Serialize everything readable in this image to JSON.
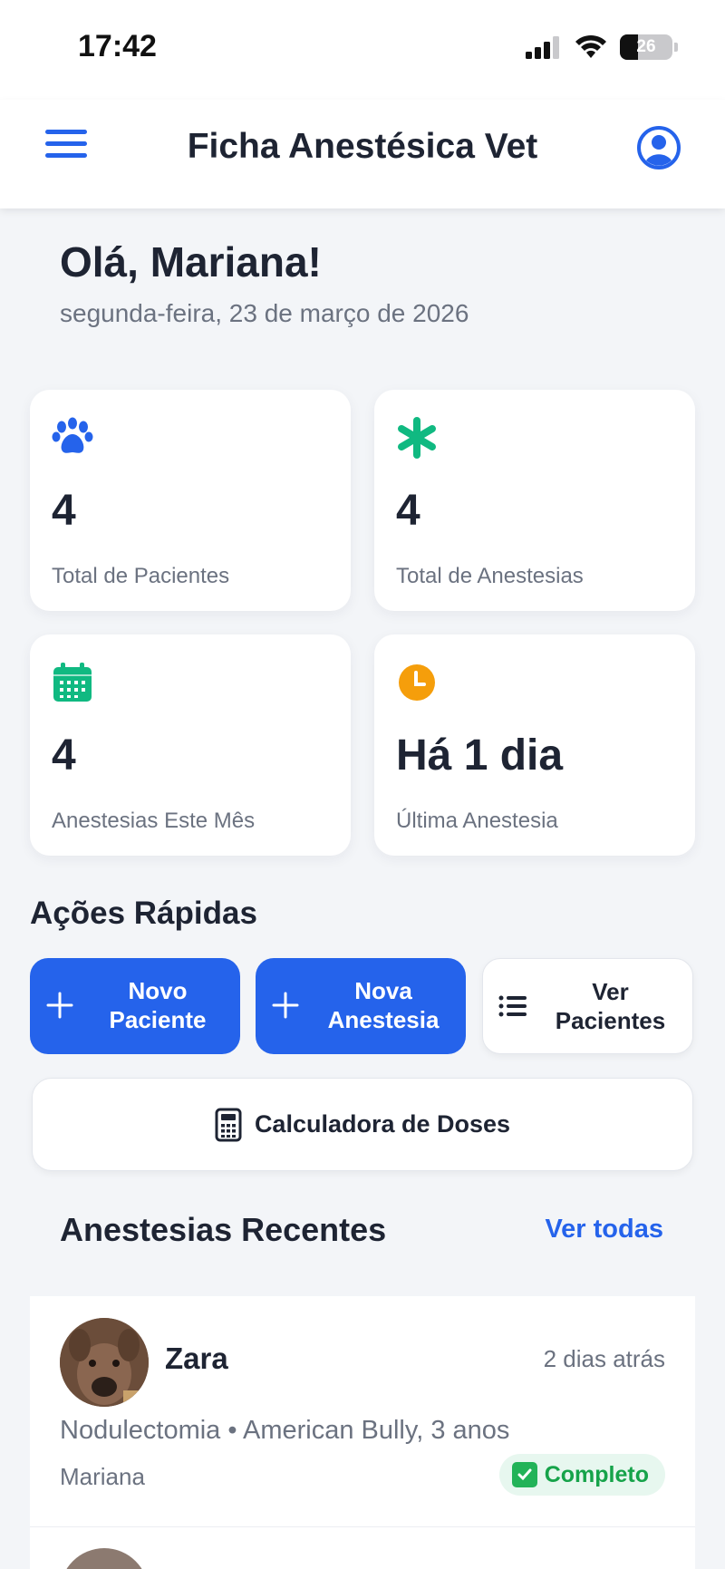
{
  "status_bar": {
    "time": "17:42",
    "battery": "26"
  },
  "header": {
    "title": "Ficha Anestésica Vet",
    "menu_icon": "menu-icon",
    "profile_icon": "user-circle-icon"
  },
  "greeting": {
    "text": "Olá, Mariana!",
    "date": "segunda-feira, 23 de março de 2026"
  },
  "stats": [
    {
      "icon": "paw-icon",
      "color": "#2563eb",
      "value": "4",
      "label": "Total de Pacientes"
    },
    {
      "icon": "asterisk-icon",
      "color": "#10b981",
      "value": "4",
      "label": "Total de Anestesias"
    },
    {
      "icon": "calendar-icon",
      "color": "#10b981",
      "value": "4",
      "label": "Anestesias Este Mês"
    },
    {
      "icon": "clock-icon",
      "color": "#f59e0b",
      "value": "Há 1 dia",
      "label": "Última Anestesia"
    }
  ],
  "quick_actions": {
    "title": "Ações Rápidas",
    "buttons": [
      {
        "icon": "plus-icon",
        "label": "Novo\nPaciente"
      },
      {
        "icon": "plus-icon",
        "label": "Nova\nAnestesia"
      },
      {
        "icon": "list-icon",
        "label": "Ver\nPacientes"
      }
    ],
    "calculator": {
      "icon": "calculator-icon",
      "label": "Calculadora de Doses"
    }
  },
  "recent": {
    "title": "Anestesias Recentes",
    "see_all": "Ver todas",
    "items": [
      {
        "name": "Zara",
        "time_ago": "2 dias atrás",
        "procedure": "Nodulectomia • American Bully, 3 anos",
        "vet": "Mariana",
        "status": "Completo"
      }
    ]
  },
  "colors": {
    "primary": "#2563eb",
    "success": "#16a34a",
    "background": "#f3f5f8"
  }
}
